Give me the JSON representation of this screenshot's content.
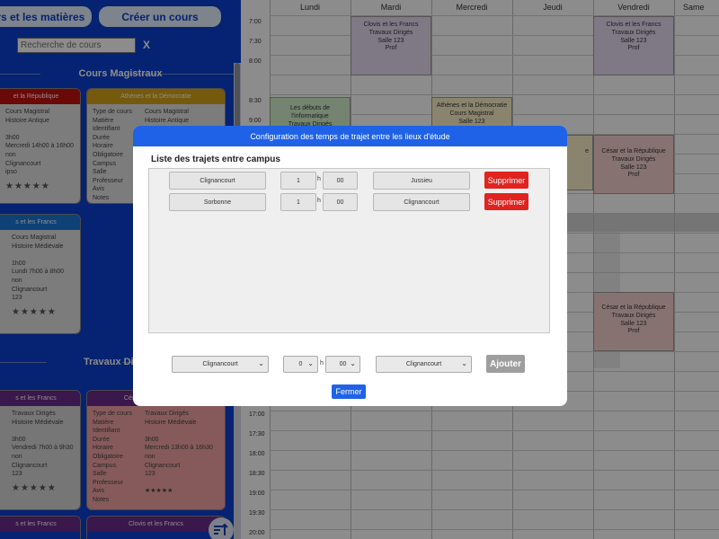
{
  "sidebar": {
    "courses_button": "ours et les matières",
    "create_button": "Créer un cours",
    "search_placeholder": "Recherche de cours",
    "search_clear": "X",
    "section_cm": "Cours Magistraux",
    "section_td": "Travaux Dirigés",
    "cards": [
      {
        "header": "et la République",
        "header_color": "#c41212",
        "body_color": "#e2e2e2",
        "cols": [
          [
            "Cours Magistral",
            "Histoire Antique",
            "",
            "3h00",
            "Mercredi 14h00 à 16h00",
            "non",
            "Clignancourt",
            "ipso"
          ]
        ],
        "stars": "★★★★★"
      },
      {
        "header": "Athènes et la Démocratie",
        "header_color": "#d6a51a",
        "body_color": "#e2e2e2",
        "cols": [
          [
            "Type de cours",
            "Matière",
            "Identifiant",
            "Durée",
            "Horaire",
            "Obligatoire",
            "Campus",
            "Salle",
            "Professeur",
            "Avis",
            "Notes"
          ],
          [
            "Cours Magistral",
            "Histoire Antique"
          ]
        ],
        "stars": ""
      },
      {
        "header": "s et les Francs",
        "header_color": "#1a79d8",
        "body_color": "#e2e2e2",
        "cols": [
          [
            "Cours Magistral",
            "Histoire Médiévale",
            "",
            "1h00",
            "Lundi 7h00 à 8h00",
            "non",
            "Clignancourt",
            "123"
          ]
        ],
        "stars": "★★★★★"
      },
      {
        "header": "s et les Francs",
        "header_color": "#6a2a8a",
        "body_color": "#d7d7d7",
        "cols": [
          [
            "Travaux Dirigés",
            "Histoire Médiévale",
            "",
            "3h00",
            "Vendredi 7h00 à 9h30",
            "non",
            "Clignancourt",
            "123"
          ]
        ],
        "stars": "★★★★★"
      },
      {
        "header": "César et la République",
        "header_color": "#6a2a8a",
        "body_color": "#f4a5a5",
        "cols": [
          [
            "Type de cours",
            "Matière",
            "Identifiant",
            "Durée",
            "Horaire",
            "Obligatoire",
            "Campus",
            "Salle",
            "Professeur",
            "Avis",
            "Notes"
          ],
          [
            "Travaux Dirigés",
            "Histoire Médiévale",
            "",
            "3h00",
            "Mercredi 13h00 à 16h30",
            "non",
            "Clignancourt",
            "123",
            "",
            "★★★★★"
          ]
        ],
        "stars": ""
      },
      {
        "header": "s et les Francs",
        "header_color": "#6a2a8a"
      },
      {
        "header": "Clovis et les Francs",
        "header_color": "#6a2a8a"
      }
    ]
  },
  "calendar": {
    "days": [
      "Lundi",
      "Mardi",
      "Mercredi",
      "Jeudi",
      "Vendredi",
      "Same"
    ],
    "times_top": [
      "7:00",
      "7:30",
      "8:00",
      "8:30",
      "9:00"
    ],
    "times_bottom": [
      "17:00",
      "17:30",
      "18:00",
      "18:30",
      "19:00",
      "19:30",
      "20:00"
    ],
    "events": [
      {
        "lines": [
          "Clovis et les Francs",
          "Travaux Dirigés",
          "Salle 123",
          "Prof"
        ],
        "color": "#e7dcf3"
      },
      {
        "lines": [
          "Clovis et les Francs",
          "Travaux Dirigés",
          "Salle 123",
          "Prof"
        ],
        "color": "#e7dcf3"
      },
      {
        "lines": [
          "Les débuts de",
          "l'informatique",
          "Travaux Dirigés"
        ],
        "color": "#d4f0cd"
      },
      {
        "lines": [
          "Athènes et la Démocratie",
          "Cours Magistral",
          "Salle 123"
        ],
        "color": "#fbf1c9"
      },
      {
        "lines": [
          "César et la République",
          "Travaux Dirigés",
          "Salle 123",
          "Prof"
        ],
        "color": "#f6d0d0"
      },
      {
        "lines": [
          "César et la République",
          "Travaux Dirigés",
          "Salle 123",
          "Prof"
        ],
        "color": "#f6d0d0"
      },
      {
        "lines": [
          "e"
        ],
        "color": "#fbf1c9"
      }
    ]
  },
  "modal": {
    "title": "Configuration des temps de trajet entre les lieux d'étude",
    "subtitle": "Liste des trajets entre campus",
    "routes": [
      {
        "from": "Clignancourt",
        "hours": "1",
        "h": "h",
        "minutes": "00",
        "to": "Jussieu",
        "delete": "Supprimer"
      },
      {
        "from": "Sorbonne",
        "hours": "1",
        "h": "h",
        "minutes": "00",
        "to": "Clignancourt",
        "delete": "Supprimer"
      }
    ],
    "add_form": {
      "from": "Clignancourt",
      "hours": "0",
      "h": "h",
      "minutes": "00",
      "to": "Clignancourt",
      "add": "Ajouter"
    },
    "close": "Fermer"
  },
  "colors": {
    "sidebar_bg": "#0b3fd0",
    "modal_header": "#1f62e8",
    "delete_red": "#e1231f",
    "add_gray": "#9e9e9e"
  }
}
